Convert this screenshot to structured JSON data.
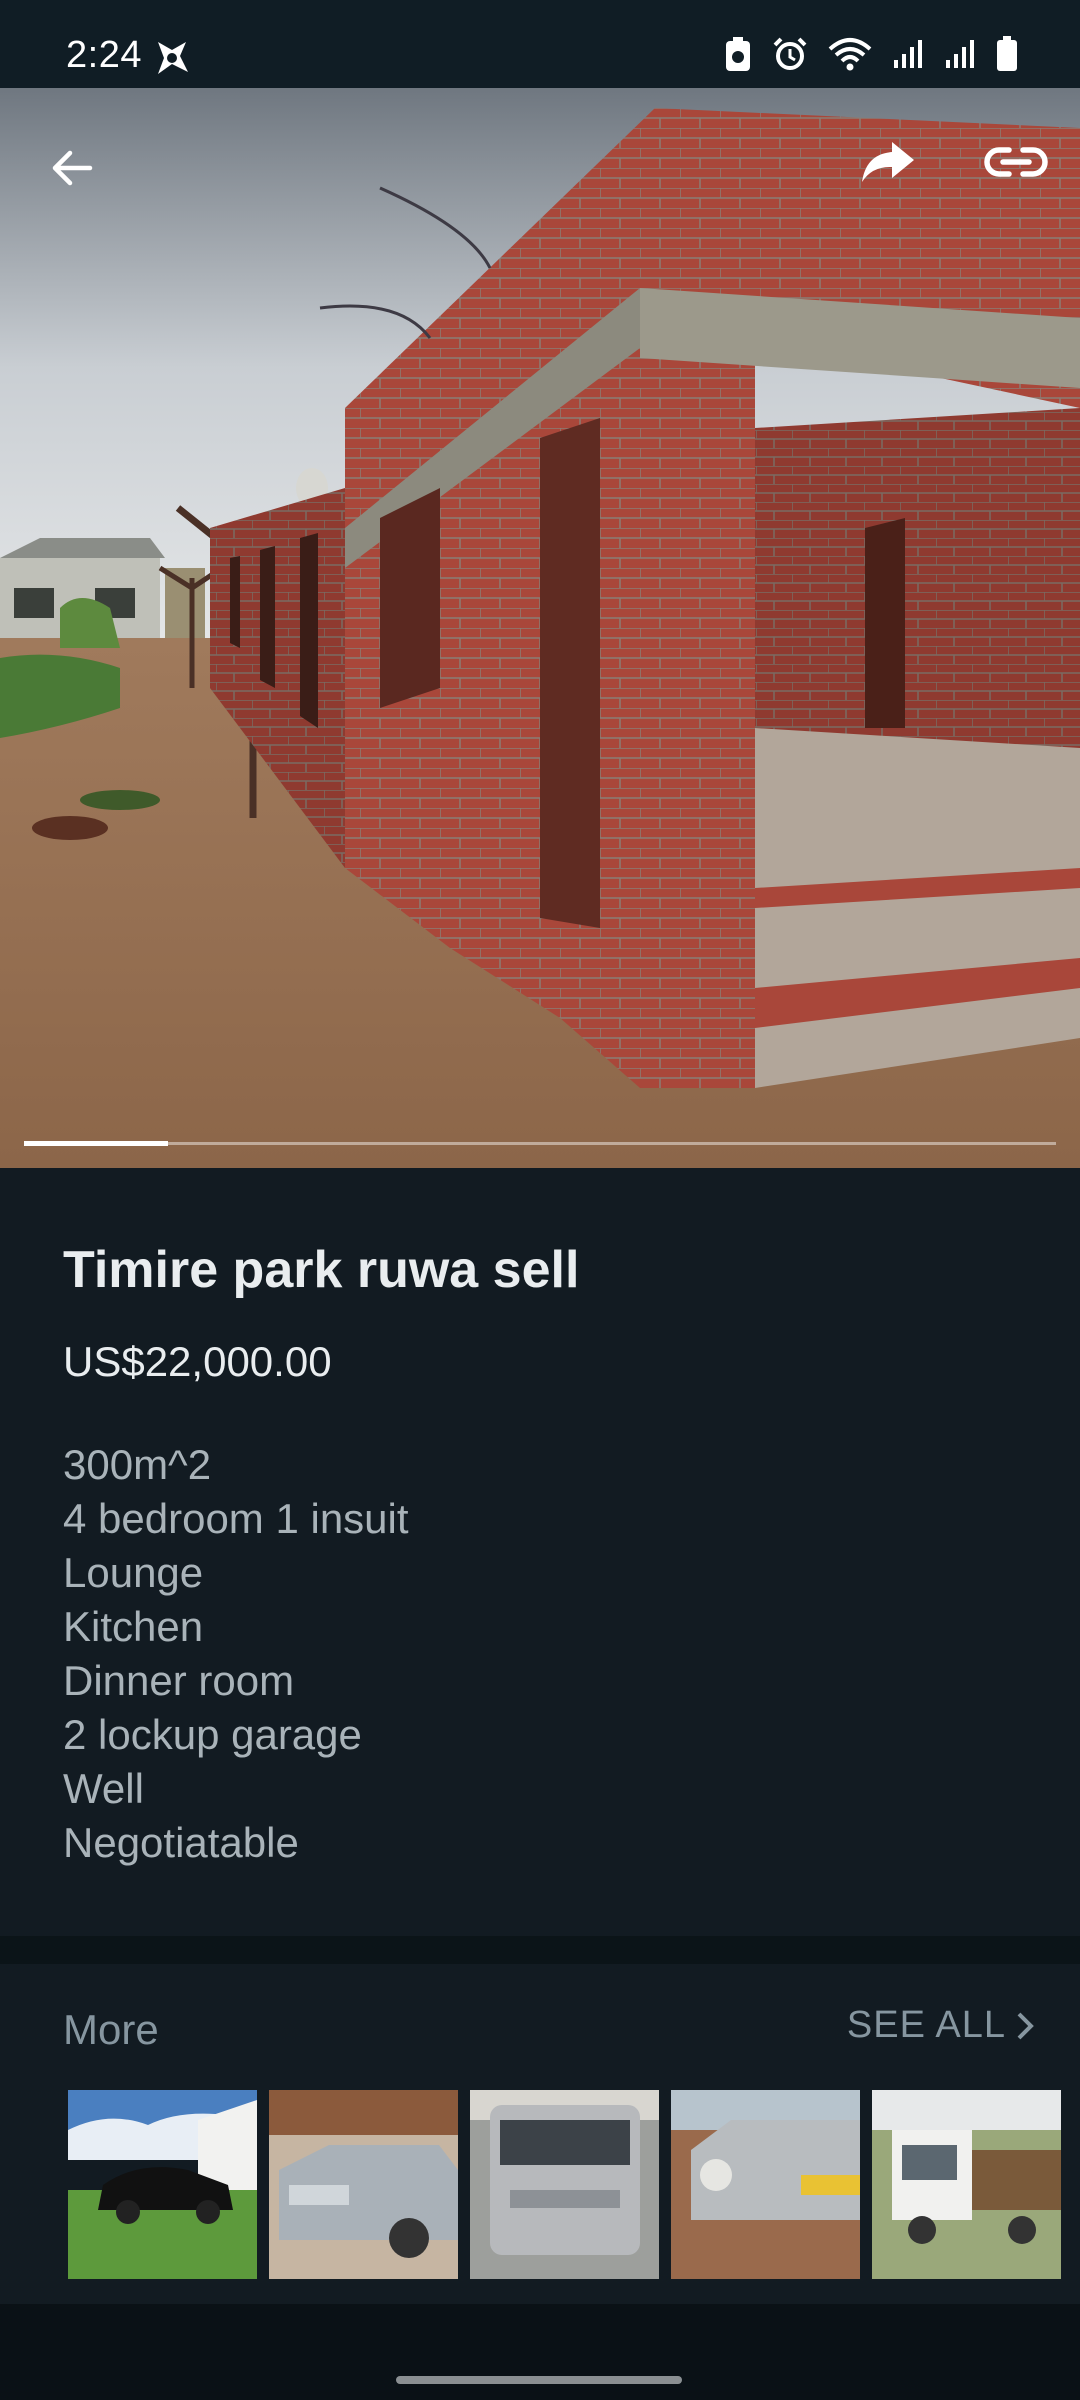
{
  "status_bar": {
    "time": "2:24",
    "icons": [
      "app-notification-icon",
      "battery-saver-icon",
      "alarm-icon",
      "wifi-icon",
      "signal-icon",
      "signal-icon-2",
      "battery-icon"
    ]
  },
  "toolbar": {
    "back_icon": "arrow-left-icon",
    "share_icon": "share-forward-icon",
    "link_icon": "link-icon"
  },
  "gallery": {
    "progress": 0.14
  },
  "listing": {
    "title": "Timire park ruwa sell",
    "price": "US$22,000.00",
    "description_lines": [
      "300m^2",
      "4 bedroom 1 insuit",
      "Lounge",
      "Kitchen",
      "Dinner room",
      "2 lockup garage",
      "Well",
      "Negotiatable"
    ]
  },
  "more": {
    "label": "More",
    "see_all": "SEE ALL",
    "thumbnails": [
      "black-sedan",
      "silver-suv",
      "silver-van",
      "silver-mercedes",
      "white-truck"
    ]
  },
  "colors": {
    "background": "#121b22",
    "text_primary": "#e9edef",
    "text_secondary": "#8696a0"
  }
}
